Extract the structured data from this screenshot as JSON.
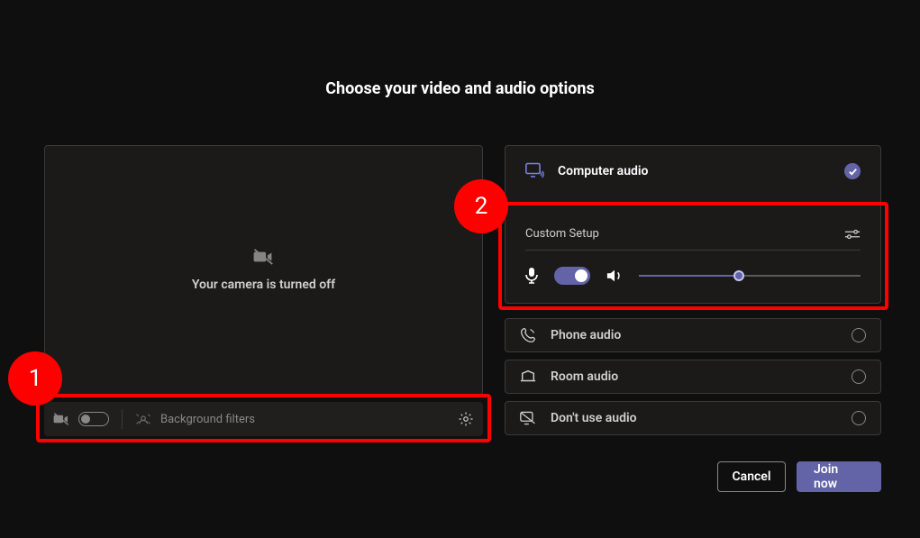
{
  "title": "Choose your video and audio options",
  "video": {
    "camera_off_text": "Your camera is turned off",
    "background_filters_label": "Background filters"
  },
  "audio": {
    "computer_audio_label": "Computer audio",
    "custom_setup_label": "Custom Setup",
    "volume_percent": 45,
    "phone_label": "Phone audio",
    "room_label": "Room audio",
    "none_label": "Don't use audio"
  },
  "buttons": {
    "cancel": "Cancel",
    "join": "Join now"
  },
  "annotations": {
    "marker1": "1",
    "marker2": "2"
  },
  "colors": {
    "accent": "#6264a7",
    "highlight": "#ff0000"
  }
}
